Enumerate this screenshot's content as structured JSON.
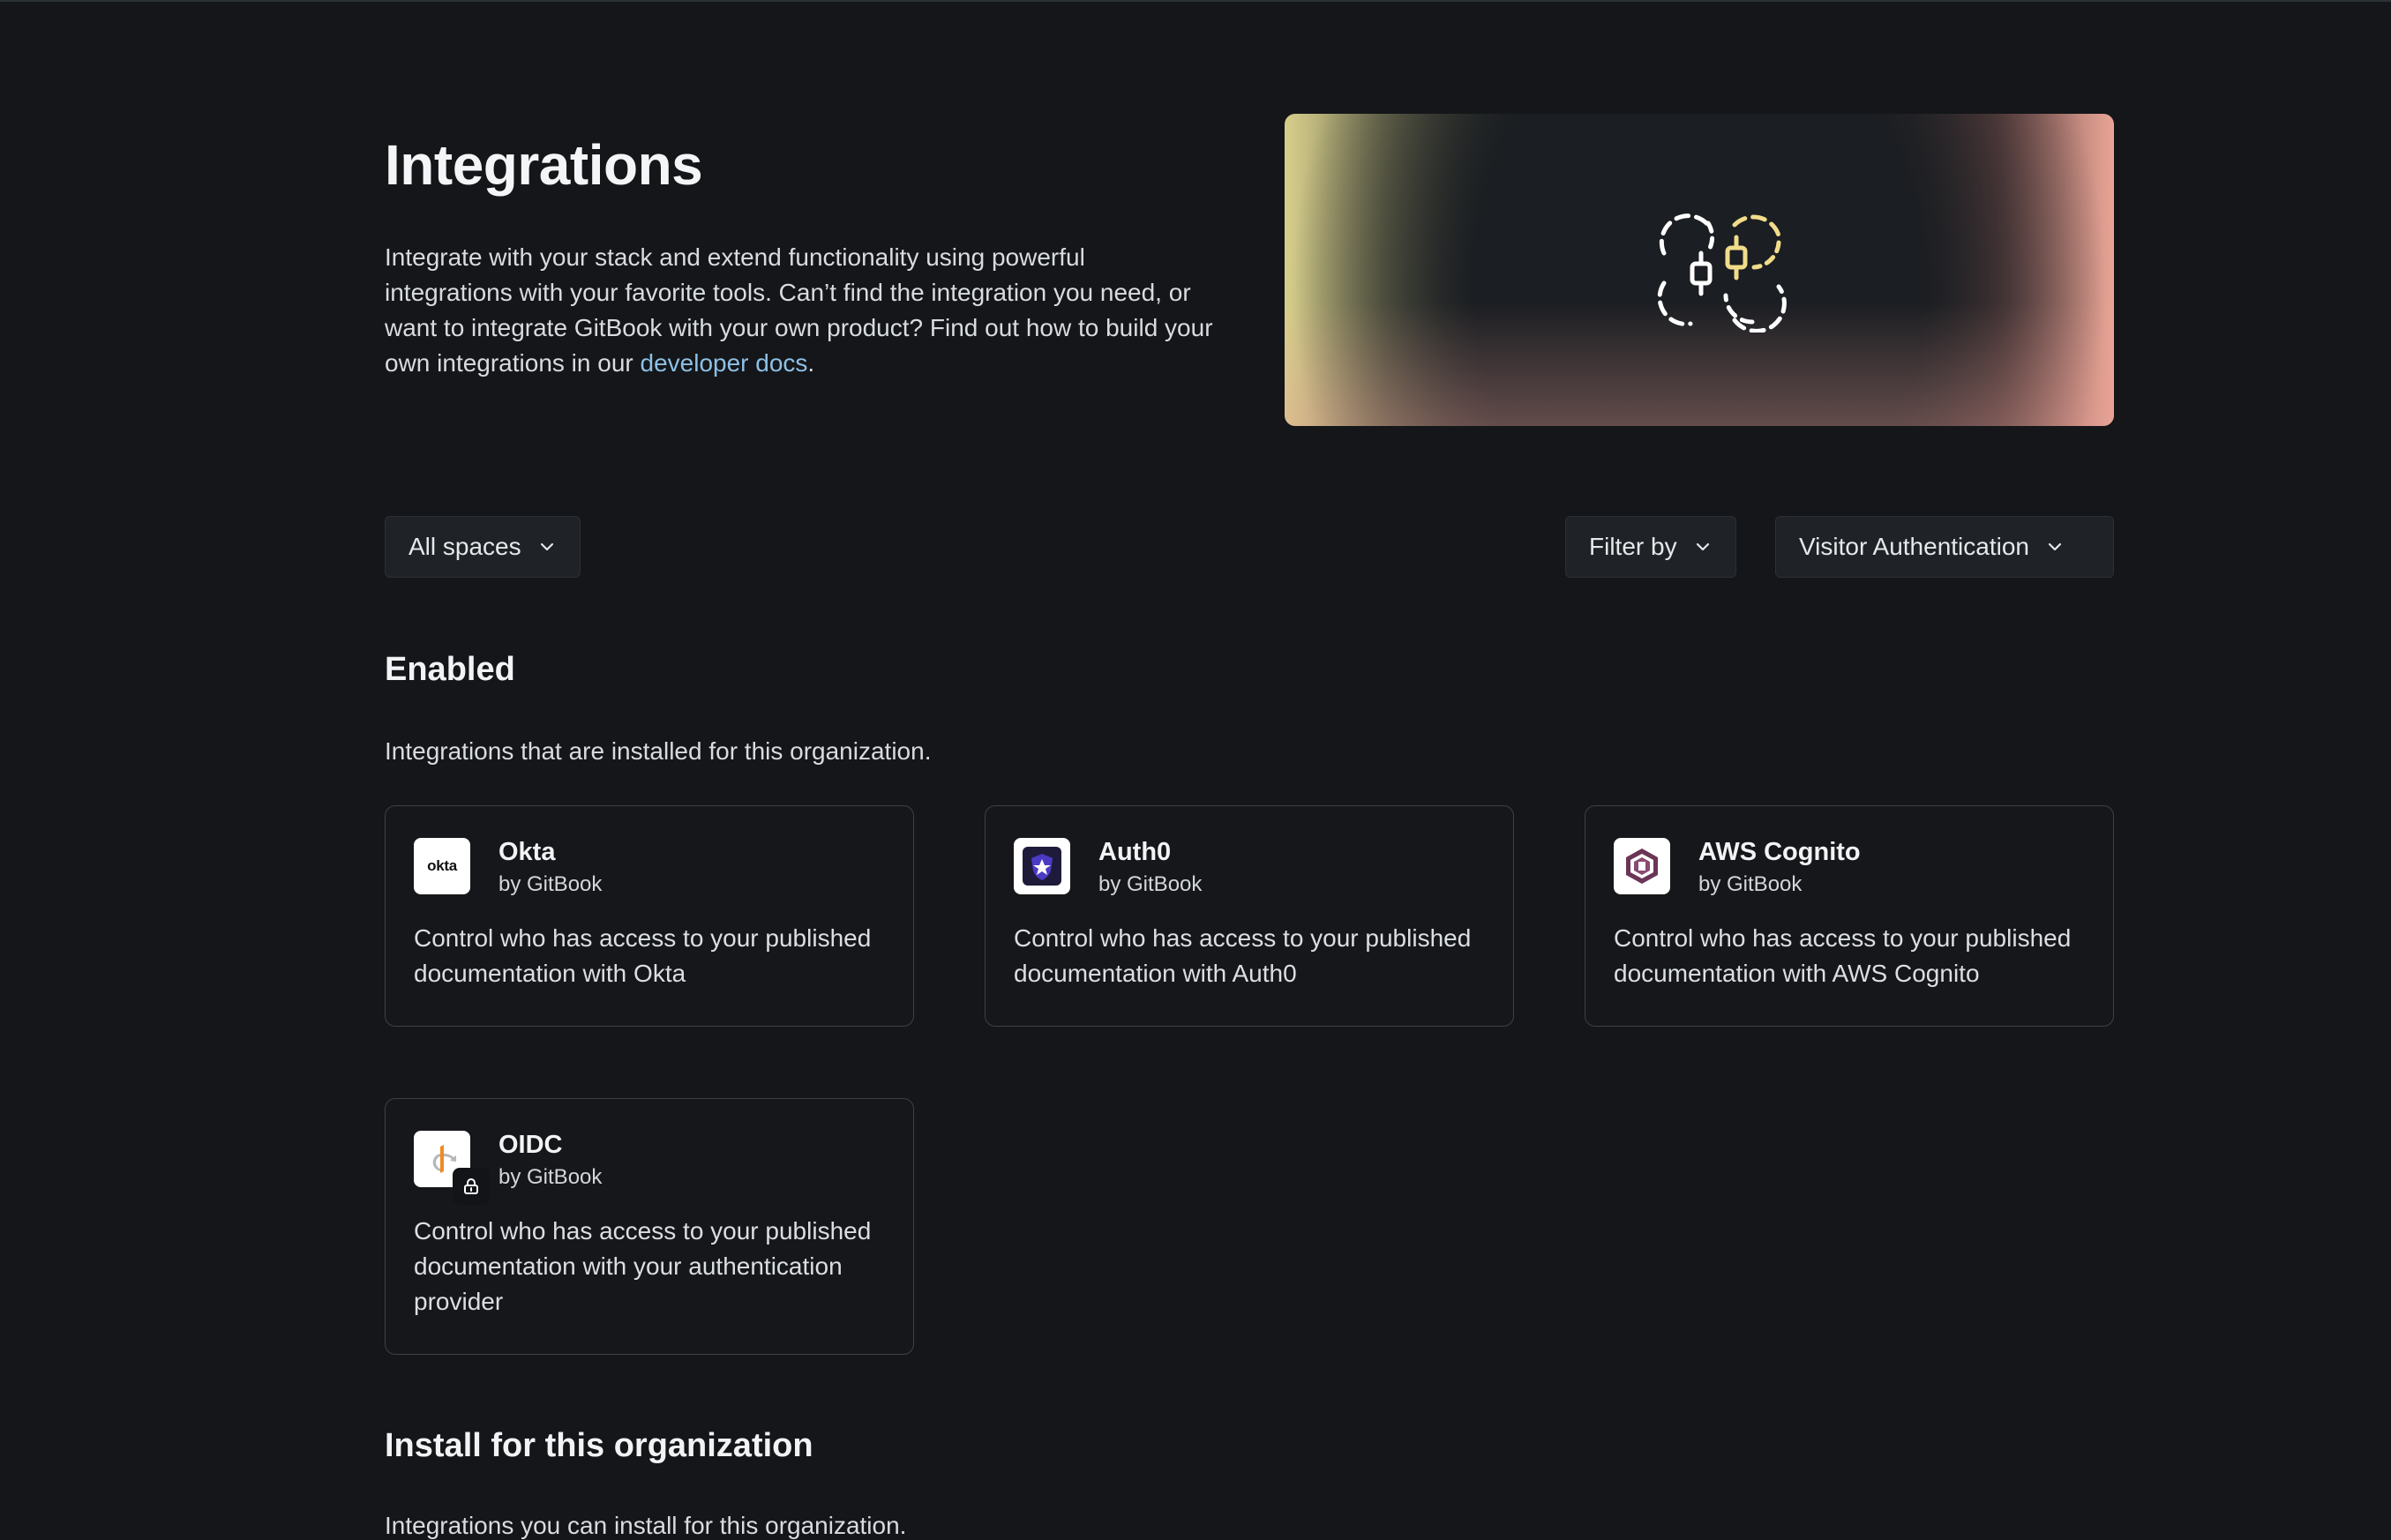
{
  "header": {
    "title": "Integrations",
    "intro_text": "Integrate with your stack and extend functionality using powerful integrations with your favorite tools. Can’t find the integration you need, or want to integrate GitBook with your own product? Find out how to build your own integrations in our ",
    "intro_link": "developer docs",
    "intro_end": "."
  },
  "filters": {
    "spaces_label": "All spaces",
    "filter_label": "Filter by",
    "category_label": "Visitor Authentication"
  },
  "enabled": {
    "title": "Enabled",
    "description": "Integrations that are installed for this organization.",
    "cards": [
      {
        "name": "Okta",
        "by": "by GitBook",
        "logo_text": "okta",
        "description": "Control who has access to your published documentation with Okta"
      },
      {
        "name": "Auth0",
        "by": "by GitBook",
        "description": "Control who has access to your published documentation with Auth0"
      },
      {
        "name": "AWS Cognito",
        "by": "by GitBook",
        "description": "Control who has access to your published documentation with AWS Cognito"
      },
      {
        "name": "OIDC",
        "by": "by GitBook",
        "description": "Control who has access to your published documentation with your authentication provider"
      }
    ]
  },
  "install": {
    "title": "Install for this organization",
    "description": "Integrations you can install for this organization."
  },
  "icons": {
    "hero": "integration-nodes-icon",
    "chevron": "chevron-down-icon",
    "lock": "lock-icon"
  },
  "colors": {
    "background": "#141619",
    "link": "#8ec0e6",
    "hero_yellow": "#d8cf8c",
    "hero_pink": "#e9a596",
    "auth0_purple": "#3a2a88",
    "cognito_purple": "#5b2e4a"
  }
}
